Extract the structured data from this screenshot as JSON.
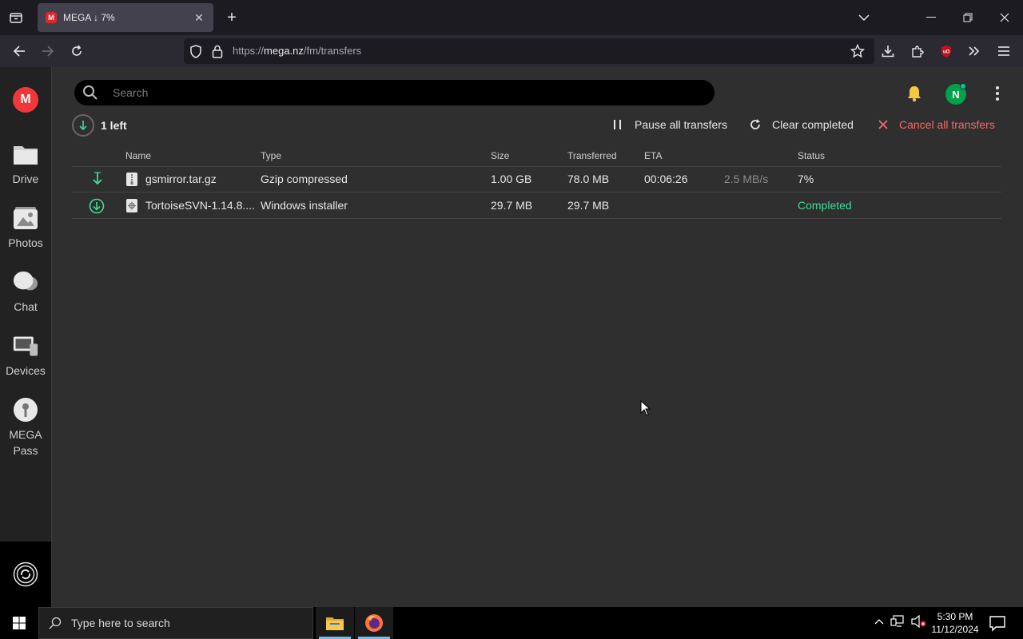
{
  "browser": {
    "tab_title": "MEGA ↓ 7%",
    "tab_favicon": "M",
    "tab_close": "✕",
    "new_tab": "+",
    "url_prefix": "https://",
    "url_host": "mega.nz",
    "url_path": "/fm/transfers"
  },
  "leftnav": {
    "logo": "M",
    "items": [
      {
        "label": "Drive",
        "icon": "folder-icon"
      },
      {
        "label": "Photos",
        "icon": "photos-icon"
      },
      {
        "label": "Chat",
        "icon": "chat-icon"
      },
      {
        "label": "Devices",
        "icon": "devices-icon"
      },
      {
        "label": "MEGA\nPass",
        "icon": "key-icon"
      }
    ]
  },
  "search": {
    "placeholder": "Search"
  },
  "header": {
    "avatar_initial": "N"
  },
  "transfers": {
    "left_count": "1 left",
    "pause_all": "Pause all transfers",
    "clear_completed": "Clear completed",
    "cancel_all": "Cancel all transfers",
    "columns": {
      "name": "Name",
      "type": "Type",
      "size": "Size",
      "transferred": "Transferred",
      "eta": "ETA",
      "status": "Status"
    },
    "rows": [
      {
        "name": "gsmirror.tar.gz",
        "type": "Gzip compressed",
        "size": "1.00 GB",
        "transferred": "78.0 MB",
        "eta": "00:06:26",
        "speed": "2.5 MB/s",
        "status": "7%"
      },
      {
        "name": "TortoiseSVN-1.14.8....",
        "type": "Windows installer",
        "size": "29.7 MB",
        "transferred": "29.7 MB",
        "eta": "",
        "speed": "",
        "status": "Completed"
      }
    ]
  },
  "taskbar": {
    "search_placeholder": "Type here to search",
    "time": "5:30 PM",
    "date": "11/12/2024"
  },
  "colors": {
    "mega_red": "#f0373a",
    "completed_green": "#3ddc97",
    "cancel_red": "#f26a6a",
    "avatar_green": "#00a14a"
  }
}
